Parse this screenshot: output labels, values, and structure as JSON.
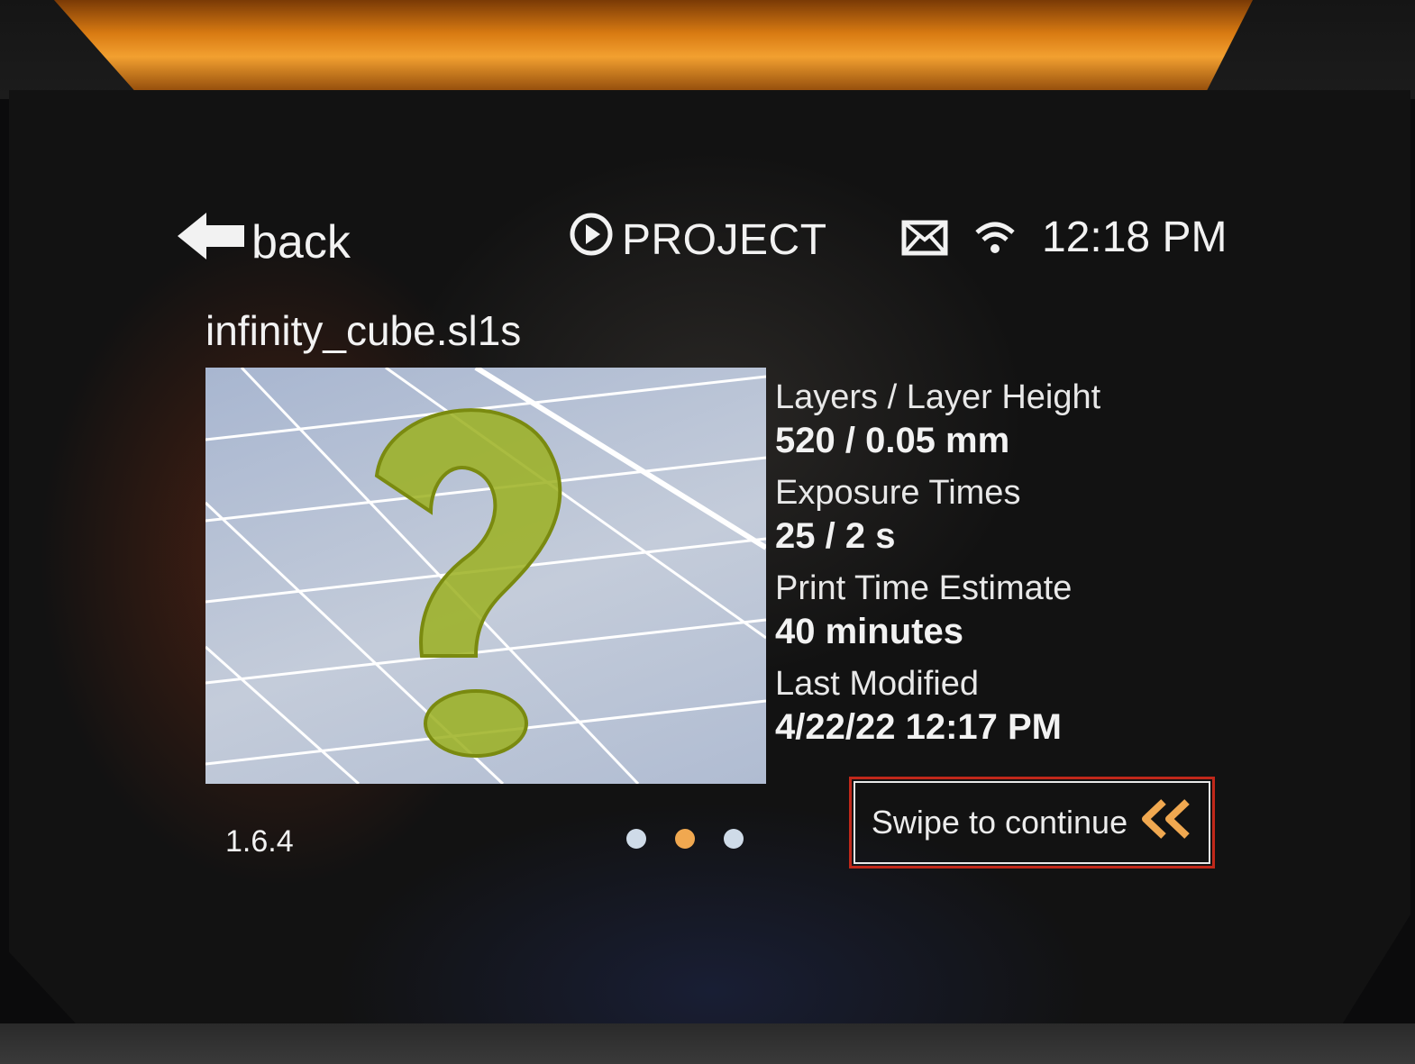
{
  "header": {
    "back_label": "back",
    "title": "PROJECT",
    "time": "12:18 PM",
    "icons": [
      "back-arrow-icon",
      "play-circle-icon",
      "mail-icon",
      "wifi-icon"
    ]
  },
  "project": {
    "filename": "infinity_cube.sl1s",
    "preview_icon": "question-mark-icon",
    "info": [
      {
        "label": "Layers / Layer Height",
        "value": "520 / 0.05 mm"
      },
      {
        "label": "Exposure Times",
        "value": "25 / 2 s"
      },
      {
        "label": "Print Time Estimate",
        "value": "40 minutes"
      },
      {
        "label": "Last Modified",
        "value": "4/22/22 12:17 PM"
      }
    ]
  },
  "footer": {
    "version": "1.6.4",
    "page_dots": {
      "count": 3,
      "active_index": 1
    },
    "swipe_label": "Swipe to continue"
  },
  "colors": {
    "accent": "#f0a850",
    "highlight_border": "#c0281a",
    "background": "#121212",
    "text": "#f2f2f2"
  }
}
